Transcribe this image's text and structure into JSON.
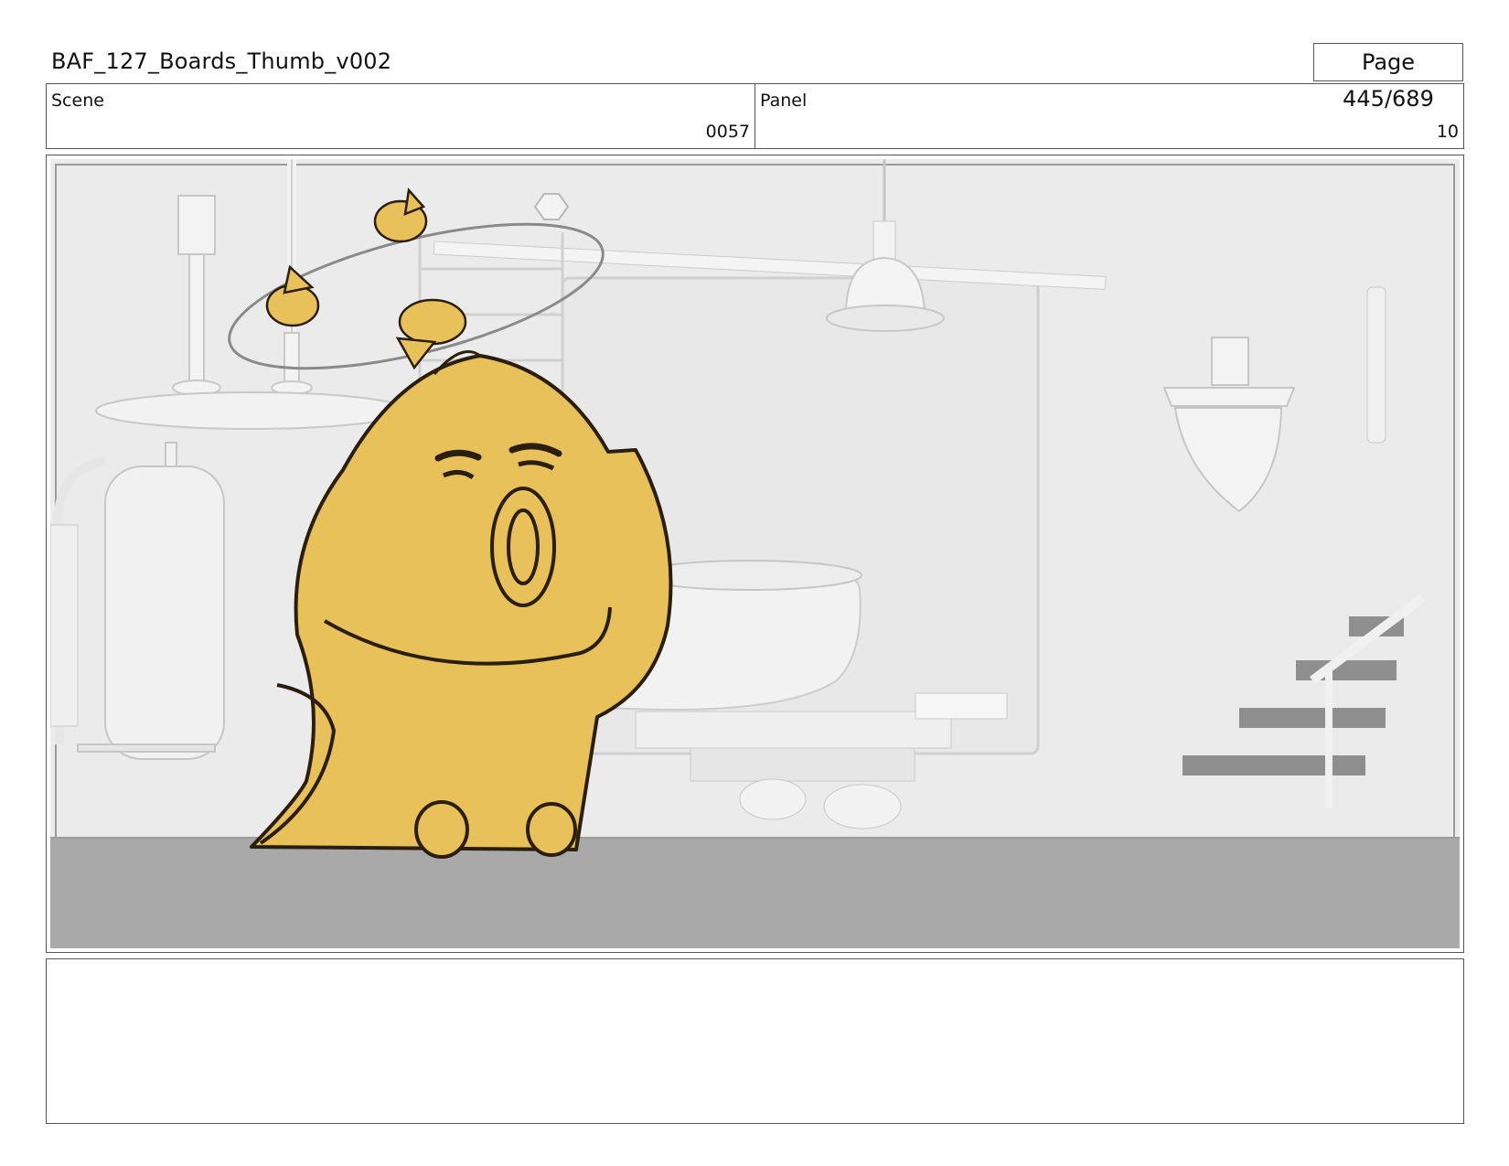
{
  "document": {
    "title": "BAF_127_Boards_Thumb_v002",
    "page_label": "Page 445/689"
  },
  "info": {
    "scene_label": "Scene",
    "scene_value": "0057",
    "panel_label": "Panel",
    "panel_value": "10"
  },
  "panel": {
    "palette": {
      "character_fill": "#e8c15a",
      "sketch_line": "#2a1e0c",
      "floor": "#a9a9a9",
      "wall": "#ebebeb",
      "props": "#f5f5f5"
    }
  },
  "notes": {
    "text": ""
  }
}
